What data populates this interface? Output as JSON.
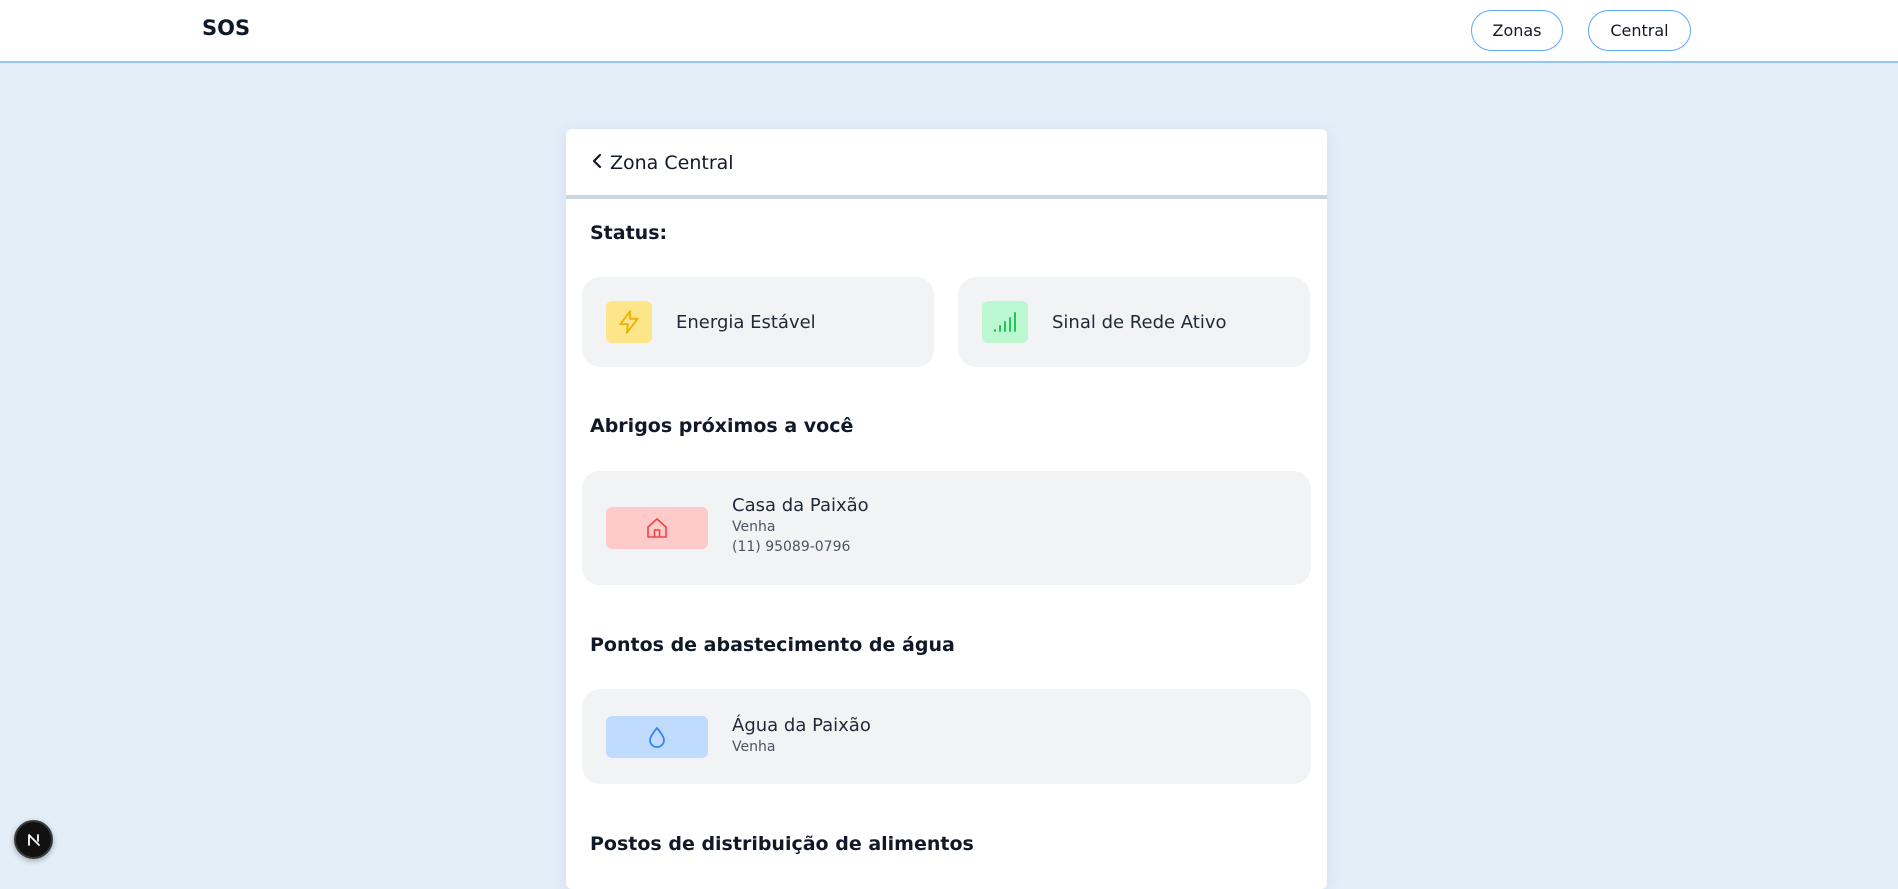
{
  "header": {
    "brand": "SOS",
    "nav": [
      {
        "label": "Zonas"
      },
      {
        "label": "Central"
      }
    ]
  },
  "zone": {
    "back_icon": "chevron-left-icon",
    "title": "Zona Central"
  },
  "status": {
    "heading": "Status:",
    "items": [
      {
        "label": "Energia Estável",
        "icon": "lightning-icon",
        "color": "#fde68a",
        "icon_color": "#eab308"
      },
      {
        "label": "Sinal de Rede Ativo",
        "icon": "signal-bars-icon",
        "color": "#bbf7d0",
        "icon_color": "#22c55e"
      }
    ]
  },
  "shelters": {
    "heading": "Abrigos próximos a você",
    "items": [
      {
        "name": "Casa da Paixão",
        "subtitle": "Venha",
        "phone": "(11) 95089-0796",
        "icon": "house-icon",
        "color": "#fecaca",
        "icon_color": "#ef4444"
      }
    ]
  },
  "water": {
    "heading": "Pontos de abastecimento de água",
    "items": [
      {
        "name": "Água da Paixão",
        "subtitle": "Venha",
        "icon": "water-drop-icon",
        "color": "#bfdbfe",
        "icon_color": "#3b82f6"
      }
    ]
  },
  "food": {
    "heading": "Postos de distribuição de alimentos"
  },
  "dev_badge": {
    "letter": "N",
    "icon": "nextjs-logo-icon"
  }
}
